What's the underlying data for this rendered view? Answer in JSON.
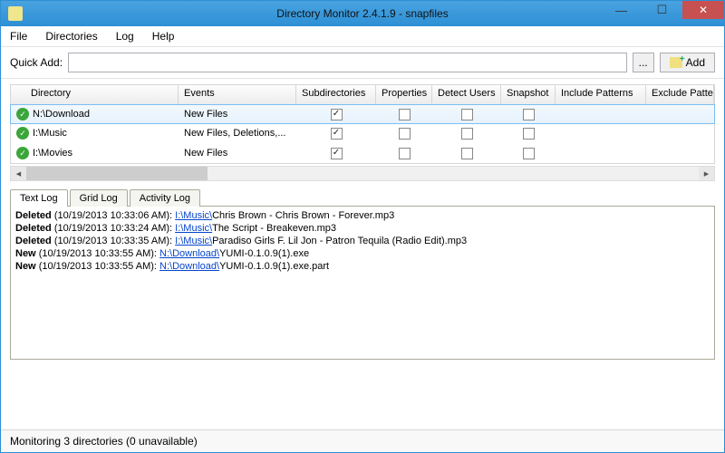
{
  "window": {
    "title": "Directory Monitor 2.4.1.9 - snapfiles"
  },
  "menubar": {
    "file": "File",
    "directories": "Directories",
    "log": "Log",
    "help": "Help"
  },
  "quickadd": {
    "label": "Quick Add:",
    "value": "",
    "browse": "...",
    "add": "Add"
  },
  "columns": {
    "dir": "Directory",
    "evt": "Events",
    "sub": "Subdirectories",
    "prop": "Properties",
    "det": "Detect Users",
    "snap": "Snapshot",
    "inc": "Include Patterns",
    "exc": "Exclude Pattern"
  },
  "rows": [
    {
      "dir": "N:\\Download",
      "evt": "New Files",
      "sub": true,
      "prop": false,
      "det": false,
      "snap": false
    },
    {
      "dir": "I:\\Music",
      "evt": "New Files, Deletions,...",
      "sub": true,
      "prop": false,
      "det": false,
      "snap": false
    },
    {
      "dir": "I:\\Movies",
      "evt": "New Files",
      "sub": true,
      "prop": false,
      "det": false,
      "snap": false
    }
  ],
  "tabs": {
    "text": "Text Log",
    "grid": "Grid Log",
    "activity": "Activity Log"
  },
  "log": [
    {
      "action": "Deleted",
      "ts": "(10/19/2013 10:33:06 AM):",
      "link": "I:\\Music\\",
      "file": "Chris Brown - Chris Brown - Forever.mp3"
    },
    {
      "action": "Deleted",
      "ts": "(10/19/2013 10:33:24 AM):",
      "link": "I:\\Music\\",
      "file": "The Script - Breakeven.mp3"
    },
    {
      "action": "Deleted",
      "ts": "(10/19/2013 10:33:35 AM):",
      "link": "I:\\Music\\",
      "file": "Paradiso Girls F. Lil Jon - Patron Tequila (Radio Edit).mp3"
    },
    {
      "action": "New",
      "ts": "(10/19/2013 10:33:55 AM):",
      "link": "N:\\Download\\",
      "file": "YUMI-0.1.0.9(1).exe"
    },
    {
      "action": "New",
      "ts": "(10/19/2013 10:33:55 AM):",
      "link": "N:\\Download\\",
      "file": "YUMI-0.1.0.9(1).exe.part"
    }
  ],
  "status": "Monitoring 3 directories (0 unavailable)"
}
